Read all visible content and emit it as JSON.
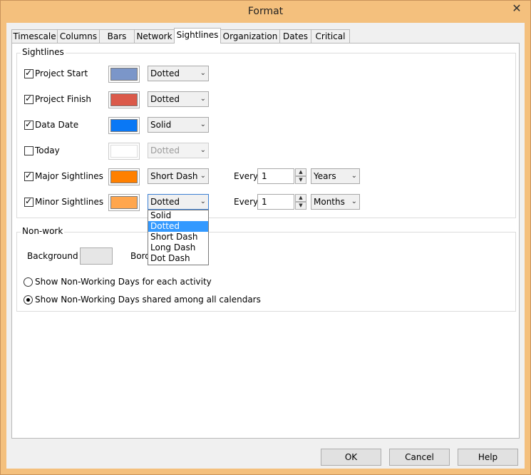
{
  "window": {
    "title": "Format",
    "close_glyph": "✕"
  },
  "tabs": [
    {
      "label": "Timescale"
    },
    {
      "label": "Columns"
    },
    {
      "label": "Bars"
    },
    {
      "label": "Network"
    },
    {
      "label": "Sightlines",
      "active": true
    },
    {
      "label": "Organization"
    },
    {
      "label": "Dates"
    },
    {
      "label": "Critical"
    }
  ],
  "sightlines": {
    "group_label": "Sightlines",
    "rows": [
      {
        "label": "Project Start",
        "checked": true,
        "color": "#7b96c9",
        "style": "Dotted"
      },
      {
        "label": "Project Finish",
        "checked": true,
        "color": "#db5a4a",
        "style": "Dotted"
      },
      {
        "label": "Data Date",
        "checked": true,
        "color": "#0a78f5",
        "style": "Solid"
      },
      {
        "label": "Today",
        "checked": false,
        "color": "#ffffff",
        "style": "Dotted"
      },
      {
        "label": "Major Sightlines",
        "checked": true,
        "color": "#ff8000",
        "style": "Short Dash",
        "every_label": "Every",
        "every_value": "1",
        "unit": "Years"
      },
      {
        "label": "Minor Sightlines",
        "checked": true,
        "color": "#ffa64d",
        "style": "Dotted",
        "every_label": "Every",
        "every_value": "1",
        "unit": "Months"
      }
    ],
    "dropdown_options": [
      "Solid",
      "Dotted",
      "Short Dash",
      "Long Dash",
      "Dot Dash"
    ],
    "dropdown_selected": "Dotted"
  },
  "nonwork": {
    "group_label": "Non-work",
    "background_label": "Background",
    "border_label_partial": "Bord",
    "radio_each": "Show Non-Working Days for each activity",
    "radio_shared": "Show Non-Working Days shared among all calendars",
    "selected": "shared"
  },
  "buttons": {
    "ok": "OK",
    "cancel": "Cancel",
    "help": "Help"
  },
  "icons": {
    "close": "close-icon",
    "dropdown": "chevron-down-icon",
    "spin_up": "spin-up-icon",
    "spin_down": "spin-down-icon"
  },
  "colors": {
    "window_frame": "#f4c07d",
    "selection": "#3399ff"
  }
}
